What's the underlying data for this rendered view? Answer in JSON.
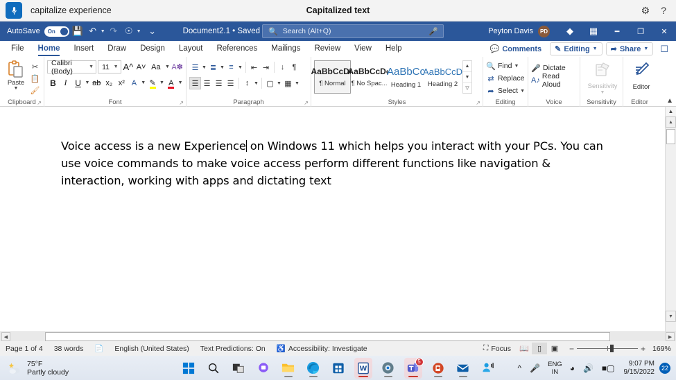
{
  "voice_access": {
    "mic_icon": "microphone-icon",
    "command_text": "capitalize experience",
    "title": "Capitalized text",
    "settings_icon": "gear-icon",
    "help_icon": "help-icon"
  },
  "word_titlebar": {
    "autosave_label": "AutoSave",
    "autosave_state": "On",
    "save_icon": "save-icon",
    "undo_icon": "undo-icon",
    "redo_icon": "redo-icon",
    "touch_icon": "touch-mode-icon",
    "customize_icon": "customize-quick-access-icon",
    "document_title": "Document2.1 • Saved",
    "search_placeholder": "Search (Alt+Q)",
    "search_icon": "search-icon",
    "search_mic_icon": "microphone-icon",
    "user_name": "Peyton Davis",
    "user_initials": "PD",
    "diamond_icon": "microsoft-365-diamond-icon",
    "ribbon_display_icon": "ribbon-display-options-icon",
    "minimize_icon": "minimize-icon",
    "restore_icon": "restore-icon",
    "close_icon": "close-icon"
  },
  "ribbon_tabs": {
    "tabs": [
      {
        "label": "File",
        "active": false
      },
      {
        "label": "Home",
        "active": true
      },
      {
        "label": "Insert",
        "active": false
      },
      {
        "label": "Draw",
        "active": false
      },
      {
        "label": "Design",
        "active": false
      },
      {
        "label": "Layout",
        "active": false
      },
      {
        "label": "References",
        "active": false
      },
      {
        "label": "Mailings",
        "active": false
      },
      {
        "label": "Review",
        "active": false
      },
      {
        "label": "View",
        "active": false
      },
      {
        "label": "Help",
        "active": false
      }
    ],
    "comments": "Comments",
    "editing": "Editing",
    "share": "Share",
    "comments_icon": "comment-bubble-icon",
    "editing_icon": "pencil-icon",
    "share_icon": "share-icon",
    "present_icon": "present-icon",
    "accent_color": "#2b579a"
  },
  "ribbon": {
    "clipboard": {
      "group_label": "Clipboard",
      "paste_label": "Paste",
      "paste_icon": "clipboard-paste-icon",
      "cut_icon": "scissors-icon",
      "copy_icon": "copy-icon",
      "format_painter_icon": "format-painter-icon",
      "launcher_icon": "dialog-launcher-icon"
    },
    "font": {
      "group_label": "Font",
      "font_name": "Calibri (Body)",
      "font_size": "11",
      "grow_font_icon": "grow-font-icon",
      "shrink_font_icon": "shrink-font-icon",
      "change_case_icon": "change-case-icon",
      "clear_formatting_icon": "clear-formatting-icon",
      "bold": "B",
      "italic": "I",
      "underline": "U",
      "strikethrough_icon": "strikethrough-icon",
      "subscript_icon": "subscript-icon",
      "superscript_icon": "superscript-icon",
      "text_effects_icon": "text-effects-icon",
      "highlight_icon": "text-highlight-icon",
      "font_color_icon": "font-color-icon",
      "highlight_color": "#ffff00",
      "font_color": "#e81123",
      "launcher_icon": "dialog-launcher-icon"
    },
    "paragraph": {
      "group_label": "Paragraph",
      "bullets_icon": "bullet-list-icon",
      "numbering_icon": "numbered-list-icon",
      "multilevel_icon": "multilevel-list-icon",
      "decrease_indent_icon": "decrease-indent-icon",
      "increase_indent_icon": "increase-indent-icon",
      "sort_icon": "sort-icon",
      "show_marks_icon": "paragraph-marks-icon",
      "align_left_icon": "align-left-icon",
      "align_center_icon": "align-center-icon",
      "align_right_icon": "align-right-icon",
      "justify_icon": "justify-icon",
      "line_spacing_icon": "line-spacing-icon",
      "shading_icon": "shading-icon",
      "borders_icon": "borders-icon",
      "launcher_icon": "dialog-launcher-icon"
    },
    "styles": {
      "group_label": "Styles",
      "items": [
        {
          "sample": "AaBbCcDc",
          "name": "¶ Normal",
          "selected": true,
          "kind": "normal"
        },
        {
          "sample": "AaBbCcDc",
          "name": "¶ No Spac...",
          "selected": false,
          "kind": "normal"
        },
        {
          "sample": "AaBbCc",
          "name": "Heading 1",
          "selected": false,
          "kind": "h1"
        },
        {
          "sample": "AaBbCcD",
          "name": "Heading 2",
          "selected": false,
          "kind": "h2"
        }
      ],
      "scroll_up_icon": "chevron-up-icon",
      "scroll_down_icon": "chevron-down-icon",
      "more_icon": "more-styles-icon",
      "launcher_icon": "dialog-launcher-icon"
    },
    "editing": {
      "group_label": "Editing",
      "find": "Find",
      "replace": "Replace",
      "select": "Select",
      "find_icon": "search-icon",
      "replace_icon": "replace-icon",
      "select_icon": "select-cursor-icon"
    },
    "voice": {
      "group_label": "Voice",
      "dictate": "Dictate",
      "read_aloud": "Read Aloud",
      "dictate_icon": "microphone-icon",
      "read_aloud_icon": "read-aloud-icon"
    },
    "sensitivity": {
      "group_label": "Sensitivity",
      "label": "Sensitivity",
      "icon": "sensitivity-label-icon",
      "disabled": true
    },
    "editor": {
      "group_label": "Editor",
      "label": "Editor",
      "icon": "editor-pen-icon"
    },
    "collapse_icon": "chevron-up-icon"
  },
  "document": {
    "paragraph_before_caret": "Voice access is a new Experience",
    "paragraph_after_caret": " on Windows 11 which helps you interact with your PCs. You can use voice commands to make voice access perform different functions like navigation & interaction, working with apps and dictating text",
    "caret": "text-cursor"
  },
  "scrollbars": {
    "v_up_icon": "triangle-up-icon",
    "v_down_icon": "triangle-down-icon",
    "v_top_icon": "chevron-up-icon",
    "h_left_icon": "triangle-left-icon",
    "h_right_icon": "triangle-right-icon"
  },
  "status_bar": {
    "page": "Page 1 of 4",
    "words": "38 words",
    "proofing_icon": "proofing-errors-icon",
    "language": "English (United States)",
    "text_predictions": "Text Predictions: On",
    "accessibility_icon": "accessibility-icon",
    "accessibility": "Accessibility: Investigate",
    "focus": "Focus",
    "focus_icon": "focus-mode-icon",
    "read_mode_icon": "read-mode-icon",
    "print_layout_icon": "print-layout-icon",
    "web_layout_icon": "web-layout-icon",
    "zoom_out_icon": "minus-icon",
    "zoom_in_icon": "plus-icon",
    "zoom_level": "169%"
  },
  "taskbar": {
    "weather_temp": "75°F",
    "weather_condition": "Partly cloudy",
    "weather_icon": "partly-cloudy-icon",
    "apps": [
      {
        "name": "start-button",
        "icon": "windows-logo-icon",
        "running": false,
        "active": false,
        "badge": null
      },
      {
        "name": "search-taskbar",
        "icon": "search-icon",
        "running": false,
        "active": false,
        "badge": null
      },
      {
        "name": "task-view",
        "icon": "task-view-icon",
        "running": false,
        "active": false,
        "badge": null
      },
      {
        "name": "chat",
        "icon": "chat-icon",
        "running": false,
        "active": false,
        "badge": null
      },
      {
        "name": "file-explorer",
        "icon": "file-explorer-icon",
        "running": true,
        "active": false,
        "badge": null
      },
      {
        "name": "microsoft-edge",
        "icon": "edge-icon",
        "running": true,
        "active": false,
        "badge": null
      },
      {
        "name": "microsoft-store",
        "icon": "store-icon",
        "running": false,
        "active": false,
        "badge": null
      },
      {
        "name": "microsoft-word",
        "icon": "word-icon",
        "running": true,
        "active": true,
        "badge": null
      },
      {
        "name": "settings",
        "icon": "settings-gear-icon",
        "running": true,
        "active": false,
        "badge": null
      },
      {
        "name": "microsoft-teams",
        "icon": "teams-icon",
        "running": true,
        "active": true,
        "badge": "5"
      },
      {
        "name": "powerpoint",
        "icon": "powerpoint-icon",
        "running": true,
        "active": false,
        "badge": null
      },
      {
        "name": "mail",
        "icon": "mail-icon",
        "running": true,
        "active": false,
        "badge": null
      },
      {
        "name": "voice-access",
        "icon": "voice-access-icon",
        "running": false,
        "active": false,
        "badge": null
      }
    ],
    "tray": {
      "show_hidden_icon": "chevron-up-icon",
      "mic_icon": "microphone-icon",
      "language_top": "ENG",
      "language_bottom": "IN",
      "wifi_icon": "wifi-icon",
      "volume_icon": "volume-icon",
      "battery_icon": "battery-icon",
      "time": "9:07 PM",
      "date": "9/15/2022",
      "notification_count": "22"
    }
  }
}
